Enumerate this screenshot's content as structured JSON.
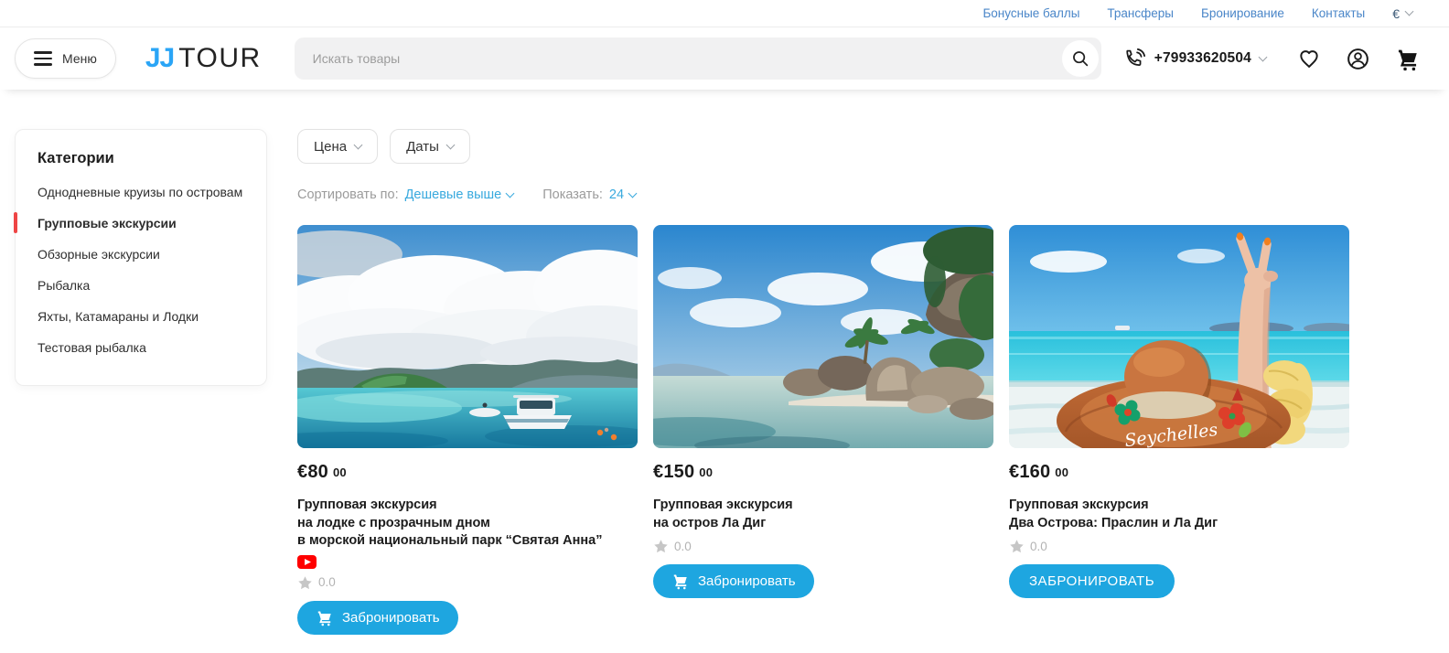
{
  "topbar": {
    "links": [
      "Бонусные баллы",
      "Трансферы",
      "Бронирование",
      "Контакты"
    ],
    "currency": "€"
  },
  "header": {
    "menu_label": "Меню",
    "logo": {
      "part1": "JJ",
      "part2": "TOUR"
    },
    "search": {
      "placeholder": "Искать товары"
    },
    "phone": "+79933620504"
  },
  "sidebar": {
    "title": "Категории",
    "items": [
      {
        "label": "Однодневные круизы по островам",
        "active": false
      },
      {
        "label": "Групповые экскурсии",
        "active": true
      },
      {
        "label": "Обзорные экскурсии",
        "active": false
      },
      {
        "label": "Рыбалка",
        "active": false
      },
      {
        "label": "Яхты, Катамараны и Лодки",
        "active": false
      },
      {
        "label": "Тестовая рыбалка",
        "active": false
      }
    ]
  },
  "toolbar": {
    "price_filter": "Цена",
    "dates_filter": "Даты",
    "sort_label": "Сортировать по:",
    "sort_value": "Дешевые выше",
    "show_label": "Показать:",
    "show_value": "24"
  },
  "products": [
    {
      "price": "€80",
      "cents": "00",
      "title_line1": "Групповая экскурсия",
      "title_line2": "на лодке с прозрачным дном",
      "title_line3": "в морской национальный парк “Святая Анна”",
      "rating": "0.0",
      "button": "Забронировать",
      "image_alt": "boat-on-turquoise-sea-with-mountains"
    },
    {
      "price": "€150",
      "cents": "00",
      "title_line1": "Групповая экскурсия",
      "title_line2": "на остров Ла Диг",
      "rating": "0.0",
      "button": "Забронировать",
      "image_alt": "la-digue-granite-rocks-beach"
    },
    {
      "price": "€160",
      "cents": "00",
      "title_line1": "Групповая экскурсия",
      "title_line2": "Два Острова: Праслин и Ла Диг",
      "rating": "0.0",
      "button": "ЗАБРОНИРОВАТЬ",
      "image_text": "Seychelles",
      "image_alt": "straw-hat-and-peace-sign-over-turquoise-sea"
    }
  ],
  "colors": {
    "accent_blue": "#1ea6e0",
    "topbar_link_blue": "#4a86c8",
    "sort_link_blue": "#38a9de",
    "logo_blue": "#2aa5f6",
    "active_category_red": "#ee4545",
    "youtube_red": "#ff0000"
  }
}
